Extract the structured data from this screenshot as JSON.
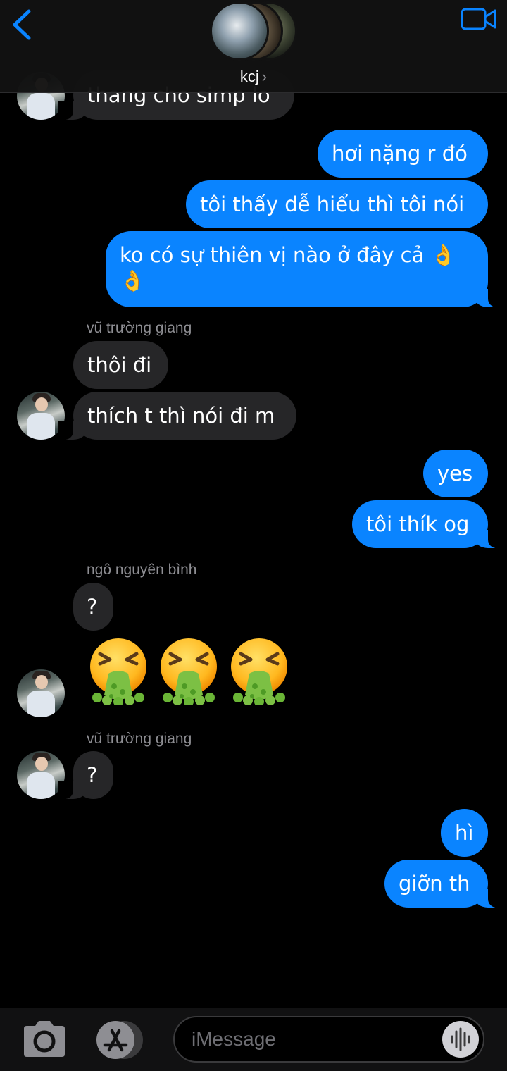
{
  "header": {
    "chat_title": "kcj",
    "chevron": "›",
    "back_icon": "chevron-left-icon",
    "video_icon": "video-camera-icon",
    "accent_color": "#0a84ff"
  },
  "messages": [
    {
      "id": "m0",
      "direction": "in",
      "text": "thang cho simp lo"
    },
    {
      "id": "m1",
      "direction": "out",
      "text": "hơi nặng r đó"
    },
    {
      "id": "m2",
      "direction": "out",
      "text": "tôi thấy dễ hiểu thì tôi nói"
    },
    {
      "id": "m3",
      "direction": "out",
      "text_line1": "ko có sự thiên vị nào ở đây cả 👌",
      "text_line2": "👌"
    },
    {
      "id": "m4",
      "direction": "in",
      "sender": "vũ trường giang",
      "text": "thôi đi"
    },
    {
      "id": "m5",
      "direction": "in",
      "text": "thích t thì nói đi m"
    },
    {
      "id": "m6",
      "direction": "out",
      "text": "yes"
    },
    {
      "id": "m7",
      "direction": "out",
      "text": "tôi thík og"
    },
    {
      "id": "m8",
      "direction": "in",
      "sender": "ngô nguyên bình",
      "text": "?"
    },
    {
      "id": "m9",
      "direction": "in",
      "emoji": "vomiting-face-icon",
      "count": 3
    },
    {
      "id": "m10",
      "direction": "in",
      "sender": "vũ trường giang",
      "text": "?"
    },
    {
      "id": "m11",
      "direction": "out",
      "text": "hì"
    },
    {
      "id": "m12",
      "direction": "out",
      "text": "giỡn th"
    }
  ],
  "composer": {
    "placeholder": "iMessage",
    "camera_icon": "camera-icon",
    "apps_icon": "app-store-icon",
    "audio_icon": "waveform-icon"
  },
  "colors": {
    "incoming_bubble": "#262628",
    "outgoing_bubble": "#0a84ff",
    "background": "#000000"
  }
}
